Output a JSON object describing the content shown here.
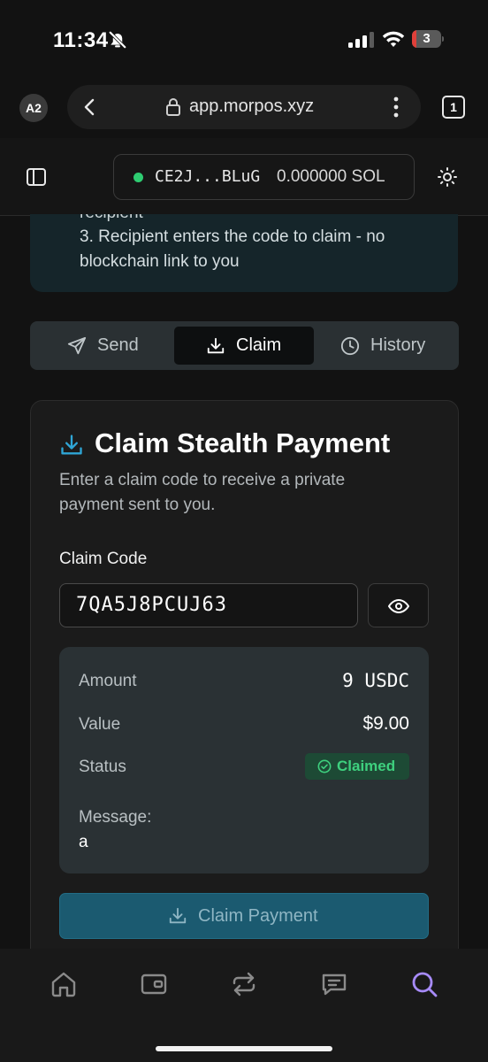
{
  "status_bar": {
    "time": "11:34",
    "battery": "3",
    "battery_level": 0.15
  },
  "browser": {
    "avatar": "A2",
    "url": "app.morpos.xyz",
    "tab_count": "1"
  },
  "header": {
    "wallet_address": "CE2J...BLuG",
    "balance": "0.000000 SOL",
    "connected_color": "#2ecc71"
  },
  "info": {
    "clipped_text": "recipient",
    "lines": [
      "3. Recipient enters the code to claim - no",
      "blockchain link to you"
    ]
  },
  "tabs": [
    {
      "label": "Send",
      "icon": "send-icon",
      "active": false
    },
    {
      "label": "Claim",
      "icon": "download-icon",
      "active": true
    },
    {
      "label": "History",
      "icon": "clock-icon",
      "active": false
    }
  ],
  "claim": {
    "title": "Claim Stealth Payment",
    "description": "Enter a claim code to receive a private payment sent to you.",
    "field_label": "Claim Code",
    "code": "7QA5J8PCUJ63",
    "details": {
      "amount_label": "Amount",
      "amount": "9 USDC",
      "value_label": "Value",
      "value": "$9.00",
      "status_label": "Status",
      "status": "Claimed",
      "message_label": "Message:",
      "message": "a"
    },
    "button_label": "Claim Payment"
  },
  "bottom_nav": [
    "home-icon",
    "wallet-icon",
    "swap-icon",
    "messages-icon",
    "search-icon"
  ],
  "colors": {
    "accent": "#1b5a70",
    "active_nav": "#a78bfa",
    "success": "#3ed07e"
  }
}
